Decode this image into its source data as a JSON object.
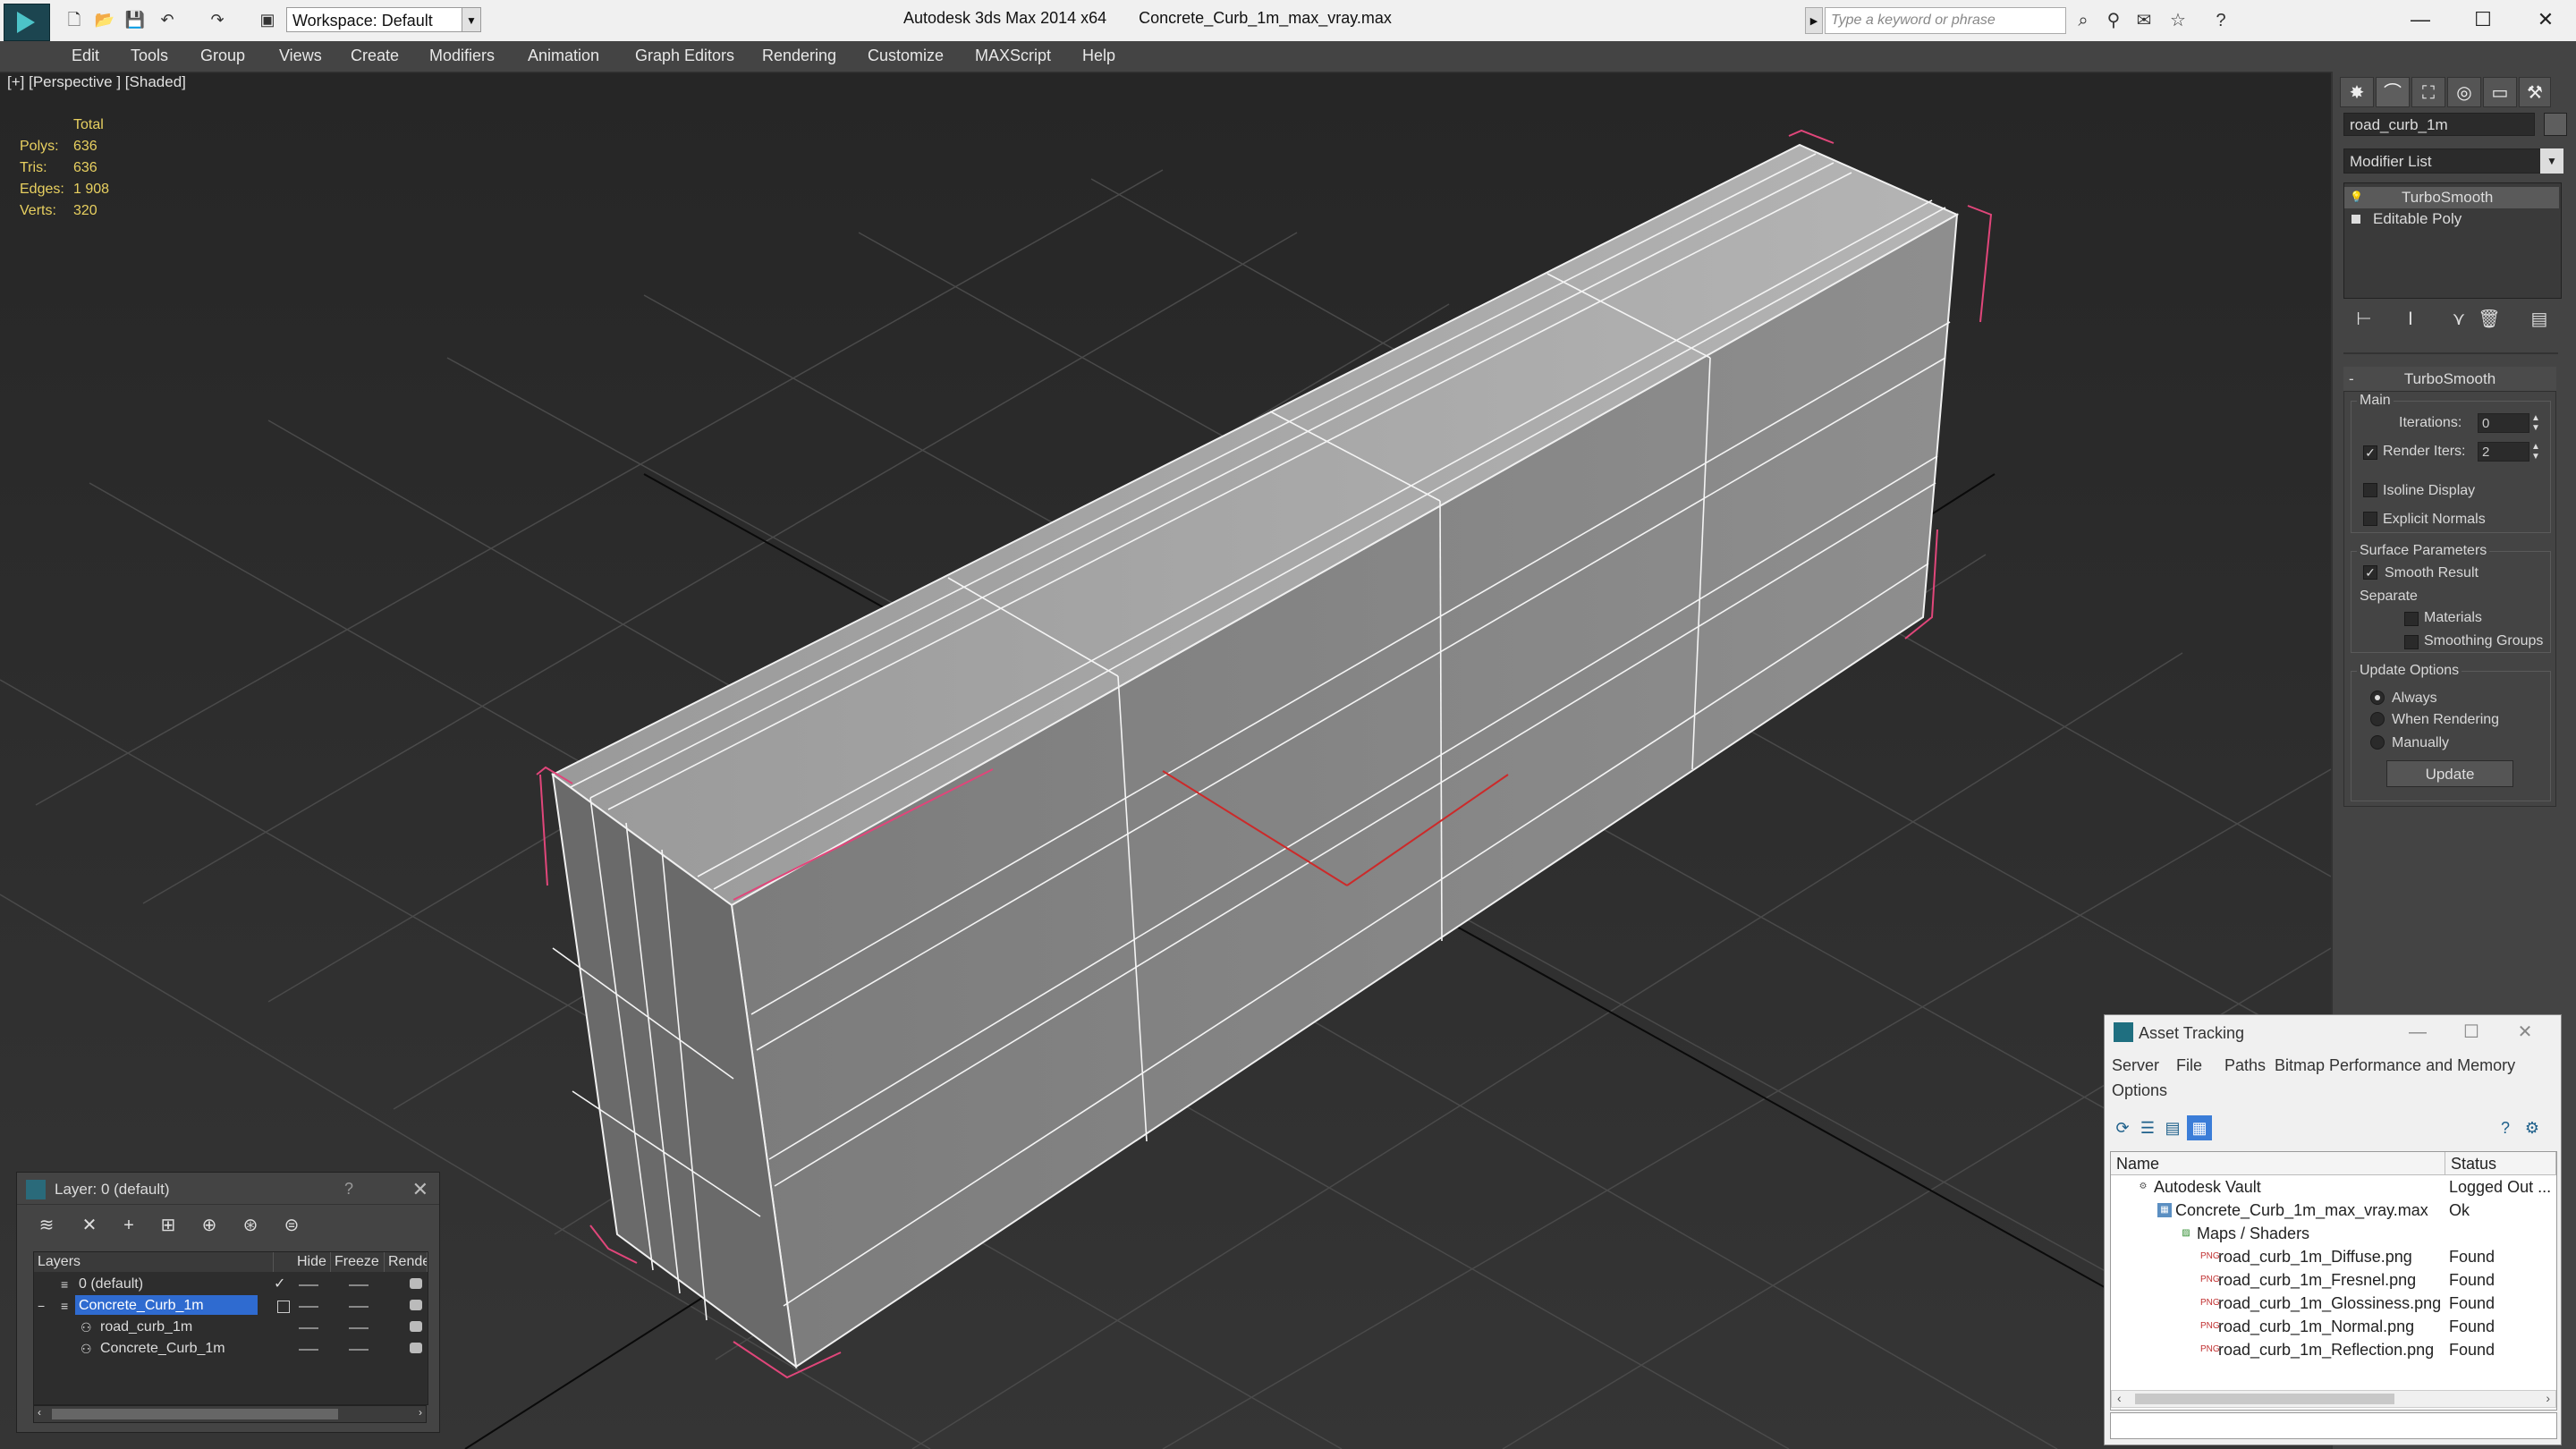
{
  "app": {
    "title": "Autodesk 3ds Max 2014 x64",
    "file": "Concrete_Curb_1m_max_vray.max",
    "workspace": "Workspace: Default",
    "search_placeholder": "Type a keyword or phrase"
  },
  "menu": [
    "Edit",
    "Tools",
    "Group",
    "Views",
    "Create",
    "Modifiers",
    "Animation",
    "Graph Editors",
    "Rendering",
    "Customize",
    "MAXScript",
    "Help"
  ],
  "viewport": {
    "label": "[+] [Perspective ] [Shaded]",
    "stats": {
      "header": "Total",
      "rows": [
        {
          "label": "Polys:",
          "value": "636"
        },
        {
          "label": "Tris:",
          "value": "636"
        },
        {
          "label": "Edges:",
          "value": "1 908"
        },
        {
          "label": "Verts:",
          "value": "320"
        }
      ]
    }
  },
  "command_panel": {
    "object_name": "road_curb_1m",
    "modifier_list": "Modifier List",
    "stack": [
      "TurboSmooth",
      "Editable Poly"
    ],
    "rollout": {
      "title": "TurboSmooth",
      "main_group": "Main",
      "iterations_label": "Iterations:",
      "iterations_value": "0",
      "render_iters_label": "Render Iters:",
      "render_iters_value": "2",
      "isoline": "Isoline Display",
      "explicit_normals": "Explicit Normals",
      "surface_group": "Surface Parameters",
      "smooth_result": "Smooth Result",
      "separate": "Separate",
      "materials": "Materials",
      "smoothing_groups": "Smoothing Groups",
      "update_group": "Update Options",
      "always": "Always",
      "when_rendering": "When Rendering",
      "manually": "Manually",
      "update_button": "Update"
    }
  },
  "layer_dialog": {
    "title": "Layer: 0 (default)",
    "help": "?",
    "columns": [
      "Layers",
      "Hide",
      "Freeze",
      "Render"
    ],
    "rows": [
      {
        "name": "0 (default)"
      },
      {
        "name": "Concrete_Curb_1m"
      },
      {
        "name": "road_curb_1m"
      },
      {
        "name": "Concrete_Curb_1m"
      }
    ]
  },
  "asset_tracking": {
    "title": "Asset Tracking",
    "menu": [
      "Server",
      "File",
      "Paths",
      "Bitmap Performance and Memory",
      "Options"
    ],
    "columns": [
      "Name",
      "Status"
    ],
    "rows": [
      {
        "name": "Autodesk Vault",
        "status": "Logged Out ..."
      },
      {
        "name": "Concrete_Curb_1m_max_vray.max",
        "status": "Ok"
      },
      {
        "name": "Maps / Shaders",
        "status": ""
      },
      {
        "name": "road_curb_1m_Diffuse.png",
        "status": "Found"
      },
      {
        "name": "road_curb_1m_Fresnel.png",
        "status": "Found"
      },
      {
        "name": "road_curb_1m_Glossiness.png",
        "status": "Found"
      },
      {
        "name": "road_curb_1m_Normal.png",
        "status": "Found"
      },
      {
        "name": "road_curb_1m_Reflection.png",
        "status": "Found"
      }
    ],
    "icon_badge": "PNG"
  }
}
